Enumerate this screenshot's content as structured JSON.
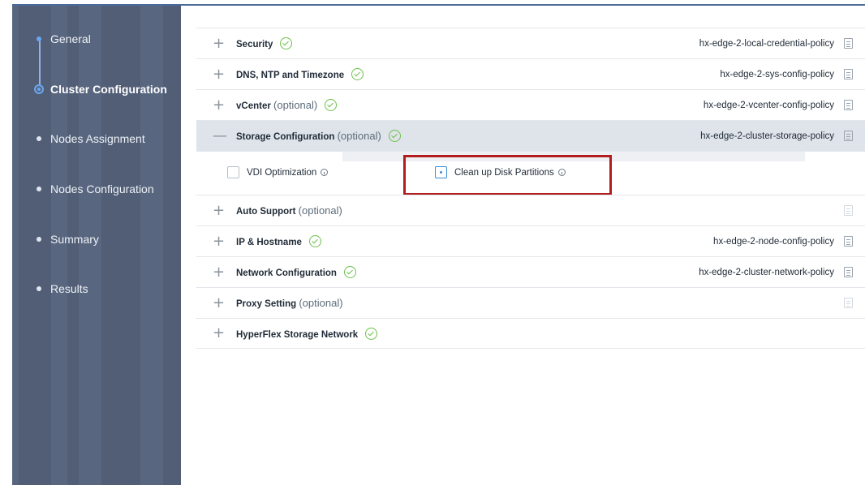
{
  "sidebar": {
    "steps": [
      {
        "label": "General",
        "state": "done"
      },
      {
        "label": "Cluster Configuration",
        "state": "active"
      },
      {
        "label": "Nodes Assignment",
        "state": "pending"
      },
      {
        "label": "Nodes Configuration",
        "state": "pending"
      },
      {
        "label": "Summary",
        "state": "pending"
      },
      {
        "label": "Results",
        "state": "pending"
      }
    ]
  },
  "sections": [
    {
      "title": "Security",
      "optional": "",
      "policy": "hx-edge-2-local-credential-policy",
      "checked": true,
      "toggle": "+"
    },
    {
      "title": "DNS, NTP and Timezone",
      "optional": "",
      "policy": "hx-edge-2-sys-config-policy",
      "checked": true,
      "toggle": "+"
    },
    {
      "title": "vCenter",
      "optional": "(optional)",
      "policy": "hx-edge-2-vcenter-config-policy",
      "checked": true,
      "toggle": "+"
    },
    {
      "title": "Storage Configuration",
      "optional": "(optional)",
      "policy": "hx-edge-2-cluster-storage-policy",
      "checked": true,
      "toggle": "—"
    },
    {
      "title": "Auto Support",
      "optional": "(optional)",
      "policy": "",
      "checked": false,
      "toggle": "+"
    },
    {
      "title": "IP & Hostname",
      "optional": "",
      "policy": "hx-edge-2-node-config-policy",
      "checked": true,
      "toggle": "+"
    },
    {
      "title": "Network Configuration",
      "optional": "",
      "policy": "hx-edge-2-cluster-network-policy",
      "checked": true,
      "toggle": "+"
    },
    {
      "title": "Proxy Setting",
      "optional": "(optional)",
      "policy": "",
      "checked": false,
      "toggle": "+"
    },
    {
      "title": "HyperFlex Storage Network",
      "optional": "",
      "policy": "",
      "checked": true,
      "toggle": "+"
    }
  ],
  "storage_options": {
    "vdi_label": "VDI Optimization",
    "vdi_checked": false,
    "cleanup_label": "Clean up Disk Partitions",
    "cleanup_checked": true
  },
  "colors": {
    "sidebar_bg": "#59667f",
    "accent": "#6aa6f0",
    "check": "#6cc04a",
    "highlight": "#b01e1e"
  }
}
